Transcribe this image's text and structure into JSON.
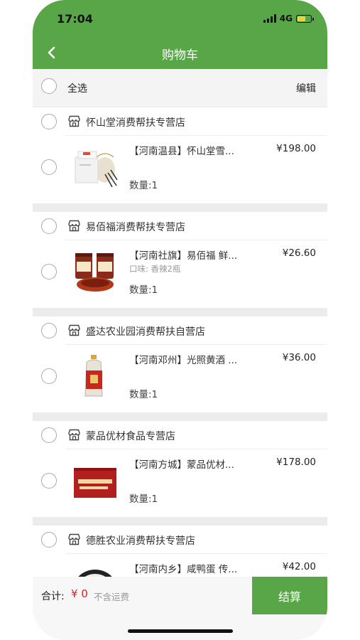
{
  "status_bar": {
    "time": "17:04",
    "network": "4G"
  },
  "nav": {
    "title": "购物车"
  },
  "select_bar": {
    "select_all": "全选",
    "edit": "编辑"
  },
  "stores": [
    {
      "name": "怀山堂消费帮扶专营店",
      "item": {
        "title": "【河南温县】怀山堂雪...",
        "price": "¥198.00",
        "option": "",
        "quantity": "数量:1",
        "image": "gift-box-product"
      }
    },
    {
      "name": "易佰福消费帮扶专营店",
      "item": {
        "title": "【河南社旗】易佰福 鲜...",
        "price": "¥26.60",
        "option": "口味: 香辣2瓶",
        "quantity": "数量:1",
        "image": "chili-sauce-jars"
      }
    },
    {
      "name": "盛达农业园消费帮扶自营店",
      "item": {
        "title": "【河南邓州】光照黄酒 ...",
        "price": "¥36.00",
        "option": "",
        "quantity": "数量:1",
        "image": "wine-bottle"
      }
    },
    {
      "name": "蒙品优材食品专营店",
      "item": {
        "title": "【河南方城】蒙品优材...",
        "price": "¥178.00",
        "option": "",
        "quantity": "数量:1",
        "image": "red-gift-box"
      }
    },
    {
      "name": "德胜农业消费帮扶专营店",
      "item": {
        "title": "【河南内乡】咸鸭蛋 传...",
        "price": "¥42.00",
        "option": "",
        "quantity": "",
        "image": "duck-egg-bowl"
      }
    }
  ],
  "footer": {
    "total_label": "合计:",
    "total_amount": "¥ 0",
    "freight_note": "不含运费",
    "checkout": "结算"
  },
  "colors": {
    "accent": "#58a648",
    "price_red": "#e02020"
  }
}
